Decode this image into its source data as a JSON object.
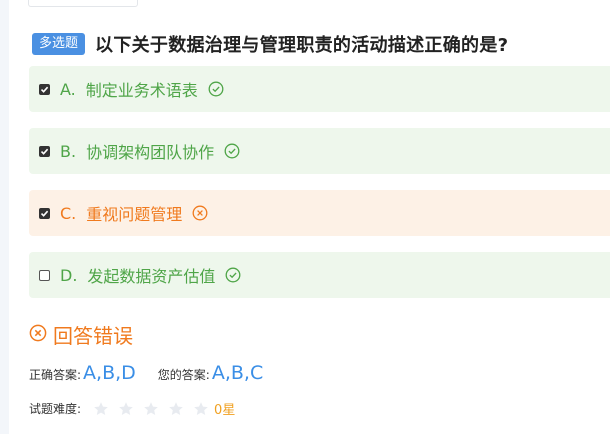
{
  "question": {
    "type_badge": "多选题",
    "title": "以下关于数据治理与管理职责的活动描述正确的是?"
  },
  "options": [
    {
      "letter": "A.",
      "text": "制定业务术语表",
      "checked": true,
      "status": "correct"
    },
    {
      "letter": "B.",
      "text": "协调架构团队协作",
      "checked": true,
      "status": "correct"
    },
    {
      "letter": "C.",
      "text": "重视问题管理",
      "checked": true,
      "status": "wrong"
    },
    {
      "letter": "D.",
      "text": "发起数据资产估值",
      "checked": false,
      "status": "correct"
    }
  ],
  "result": {
    "text": "回答错误",
    "icon": "circle-x-icon"
  },
  "answers": {
    "correct_label": "正确答案:",
    "correct_value": "A,B,D",
    "yours_label": "您的答案:",
    "yours_value": "A,B,C"
  },
  "difficulty": {
    "label": "试题难度:",
    "rating": 0,
    "max_stars": 5,
    "value_text": "0星"
  },
  "colors": {
    "correct": "#4fa548",
    "wrong": "#f07a1e",
    "correct_bg": "#eef7ec",
    "wrong_bg": "#fdf1e6",
    "badge": "#4a90e2",
    "answer": "#3a8ee6",
    "star_empty": "#e8ebf0",
    "star_text": "#f0a020"
  }
}
